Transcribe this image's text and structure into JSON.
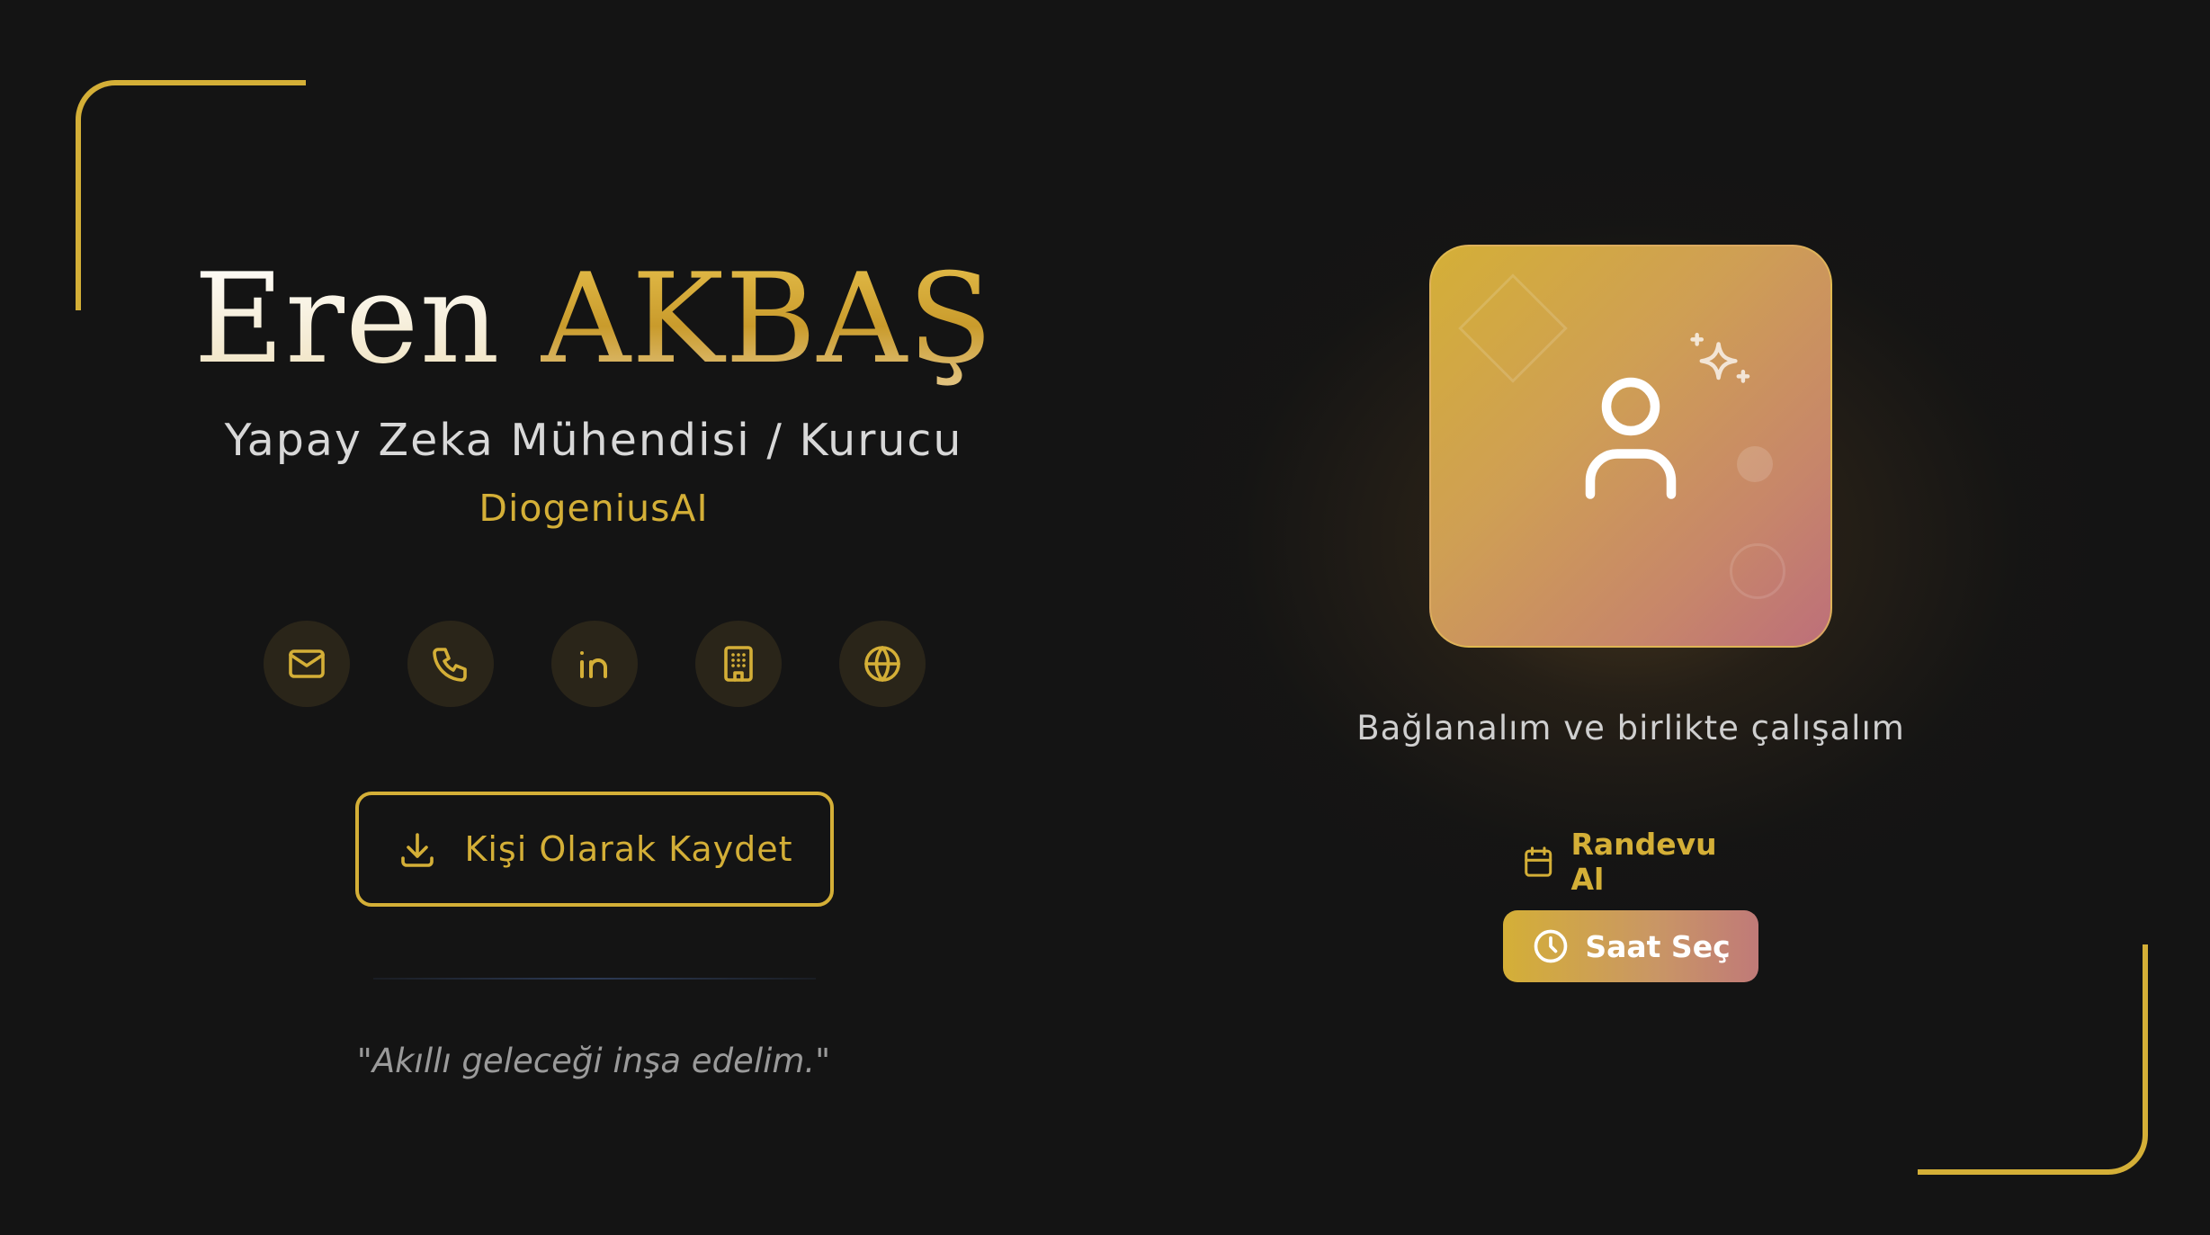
{
  "profile": {
    "first_name": "Eren",
    "last_name": "AKBAŞ",
    "title": "Yapay Zeka Mühendisi / Kurucu",
    "company": "DiogeniusAI",
    "quote": "\"Akıllı geleceği inşa edelim.\""
  },
  "contact_icons": [
    {
      "icon": "mail-icon"
    },
    {
      "icon": "phone-icon"
    },
    {
      "icon": "linkedin-icon"
    },
    {
      "icon": "building-icon"
    },
    {
      "icon": "globe-icon"
    }
  ],
  "actions": {
    "save_contact_label": "Kişi Olarak Kaydet",
    "save_contact_icon": "download-icon"
  },
  "right": {
    "avatar_icon": "user-icon",
    "tagline": "Bağlanalım ve birlikte çalışalım",
    "appointment_label": "Randevu Al",
    "appointment_icon": "calendar-icon",
    "pick_time_label": "Saat Seç",
    "pick_time_icon": "clock-icon"
  },
  "colors": {
    "background": "#141414",
    "gold": "#d4af37",
    "rose": "#bd6f7a"
  }
}
